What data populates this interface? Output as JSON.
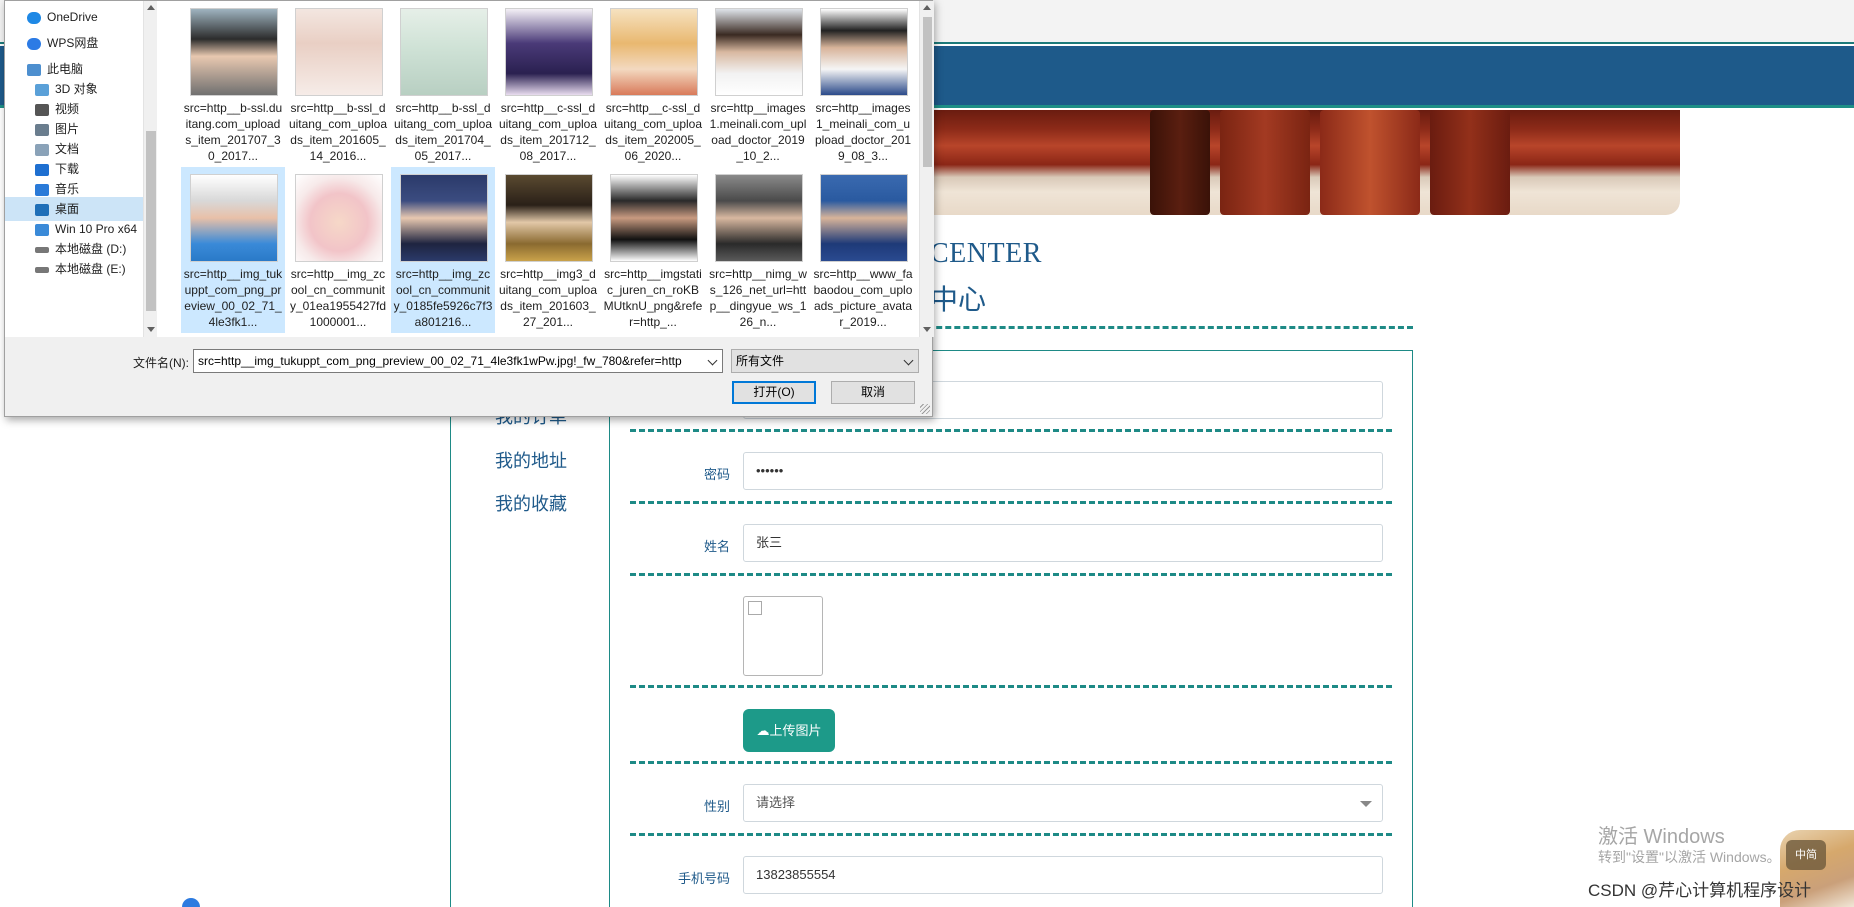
{
  "page": {
    "title_en": "CENTER",
    "title_cn": "中心",
    "side_menu": [
      "我的订单",
      "我的地址",
      "我的收藏"
    ]
  },
  "form": {
    "password_label": "密码",
    "password_value": "••••••",
    "name_label": "姓名",
    "name_value": "张三",
    "upload_label": "上传图片",
    "gender_label": "性别",
    "gender_placeholder": "请选择",
    "phone_label": "手机号码",
    "phone_value": "13823855554"
  },
  "dialog": {
    "nav": [
      "OneDrive",
      "WPS网盘",
      "此电脑",
      "3D 对象",
      "视频",
      "图片",
      "文档",
      "下载",
      "音乐",
      "桌面",
      "Win 10 Pro x64",
      "本地磁盘 (D:)",
      "本地磁盘 (E:)"
    ],
    "files": [
      "src=http__b-ssl.duitang.com_uploads_item_201707_30_2017...",
      "src=http__b-ssl_duitang_com_uploads_item_201605_14_2016...",
      "src=http__b-ssl_duitang_com_uploads_item_201704_05_2017...",
      "src=http__c-ssl_duitang_com_uploads_item_201712_08_2017...",
      "src=http__c-ssl_duitang_com_uploads_item_202005_06_2020...",
      "src=http__images1.meinali.com_upload_doctor_2019_10_2...",
      "src=http__images1_meinali_com_upload_doctor_2019_08_3...",
      "src=http__img_tukuppt_com_png_preview_00_02_71_4le3fk1...",
      "src=http__img_zcool_cn_community_01ea1955427fd1000001...",
      "src=http__img_zcool_cn_community_0185fe5926c7f3a801216...",
      "src=http__img3_duitang_com_uploads_item_201603_27_201...",
      "src=http__imgstatic_juren_cn_roKBMUtknU_png&refer=http_...",
      "src=http__nimg_ws_126_net_url=http__dingyue_ws_126_n...",
      "src=http__www_fabaodou_com_uploads_picture_avatar_2019..."
    ],
    "filename_label": "文件名(N):",
    "filename_value": "src=http__img_tukuppt_com_png_preview_00_02_71_4le3fk1wPw.jpg!_fw_780&refer=http",
    "filetype_value": "所有文件",
    "open_button": "打开(O)",
    "cancel_button": "取消"
  },
  "overlay": {
    "activation_title": "激活 Windows",
    "activation_hint": "转到\"设置\"以激活 Windows。",
    "ime_badge": "中简",
    "csdn": "CSDN @芹心计算机程序设计"
  }
}
